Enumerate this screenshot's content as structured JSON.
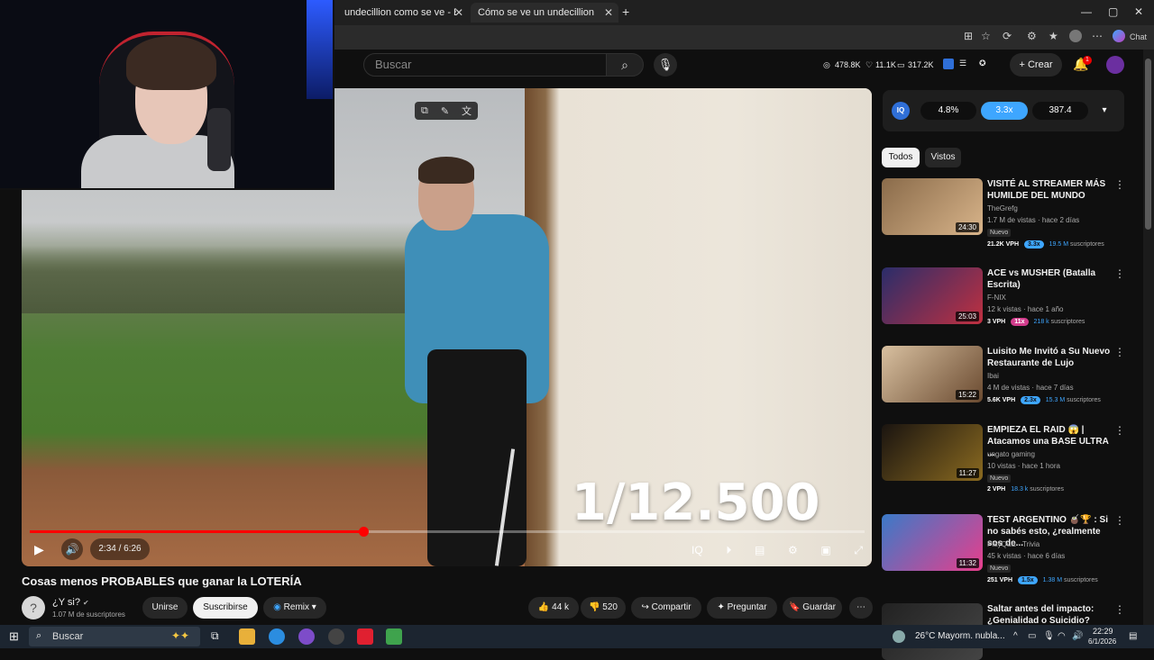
{
  "browser": {
    "tabs": [
      {
        "label": "undecillion como se ve - Búsqued"
      },
      {
        "label": "Cómo se ve un undecillion"
      }
    ],
    "new_tab": "+",
    "window_controls": [
      "—",
      "▢",
      "✕"
    ],
    "chat_label": "Chat"
  },
  "yt_header": {
    "search_placeholder": "Buscar",
    "stats": [
      "478.8K",
      "11.1K",
      "317.2K"
    ],
    "create_label": "Crear",
    "notif_count": "1"
  },
  "video": {
    "overlay_text": "1/12.500",
    "time": "2:34 / 6:26",
    "progress": 0.4,
    "title": "Cosas menos PROBABLES que ganar la LOTERÍA"
  },
  "channel": {
    "name": "¿Y si?",
    "subs": "1.07 M de suscriptores",
    "join": "Unirse",
    "subscribe": "Suscribirse",
    "remix": "Remix"
  },
  "actions": {
    "likes": "44 k",
    "dislikes": "520",
    "share": "Compartir",
    "ask": "Preguntar",
    "save": "Guardar"
  },
  "iq_panel": {
    "values": [
      "4.8%",
      "3.3x",
      "387.4"
    ]
  },
  "chips": {
    "all": "Todos",
    "seen": "Vistos"
  },
  "recommendations": [
    {
      "title": "VISITÉ AL STREAMER MÁS HUMILDE DEL MUNDO",
      "channel": "TheGrefg",
      "meta": "1.7 M de vistas · hace 2 días",
      "badge": "Nuevo",
      "vph": "21.2K VPH",
      "mult": "3.3x",
      "subs": "19.5 M",
      "subs_label": "suscriptores",
      "duration": "24:30",
      "colors": [
        "#8a6b4a",
        "#d8b48a"
      ]
    },
    {
      "title": "ACE vs MUSHER (Batalla Escrita)",
      "channel": "F-NIX",
      "meta": "12 k vistas · hace 1 año",
      "badge": "",
      "vph": "3 VPH",
      "mult": "11x",
      "subs": "218 k",
      "subs_label": "suscriptores",
      "duration": "25:03",
      "colors": [
        "#2a2d6a",
        "#c03040"
      ]
    },
    {
      "title": "Luisito Me Invitó a Su Nuevo Restaurante de Lujo",
      "channel": "Ibai",
      "meta": "4 M de vistas · hace 7 días",
      "badge": "",
      "vph": "5.6K VPH",
      "mult": "2.3x",
      "subs": "15.3 M",
      "subs_label": "suscriptores",
      "duration": "15:22",
      "colors": [
        "#d8c0a0",
        "#6a4a30"
      ]
    },
    {
      "title": "EMPIEZA EL RAID 😱 | Atacamos una BASE ULTRA ...",
      "channel": "ungato gaming",
      "meta": "10 vistas · hace 1 hora",
      "badge": "Nuevo",
      "vph": "2 VPH",
      "mult": "",
      "subs": "18.3 k",
      "subs_label": "suscriptores",
      "duration": "11:27",
      "colors": [
        "#1a1410",
        "#8a6a20"
      ]
    },
    {
      "title": "TEST ARGENTINO 🧉🏆 : Si no sabés esto, ¿realmente sos de...",
      "channel": "PlayQuiz - Trivia",
      "meta": "45 k vistas · hace 6 días",
      "badge": "Nuevo",
      "vph": "251 VPH",
      "mult": "1.5x",
      "subs": "1.38 M",
      "subs_label": "suscriptores",
      "duration": "11:32",
      "colors": [
        "#3a7ac8",
        "#e83e8c"
      ]
    },
    {
      "title": "Saltar antes del impacto: ¿Genialidad o Suicidio?",
      "channel": "",
      "meta": "",
      "badge": "",
      "vph": "",
      "mult": "",
      "subs": "",
      "subs_label": "",
      "duration": "",
      "colors": [
        "#222",
        "#444"
      ]
    }
  ],
  "taskbar": {
    "search": "Buscar",
    "weather": "26°C  Mayorm. nubla...",
    "time": "22:29",
    "date": "6/1/2026"
  }
}
